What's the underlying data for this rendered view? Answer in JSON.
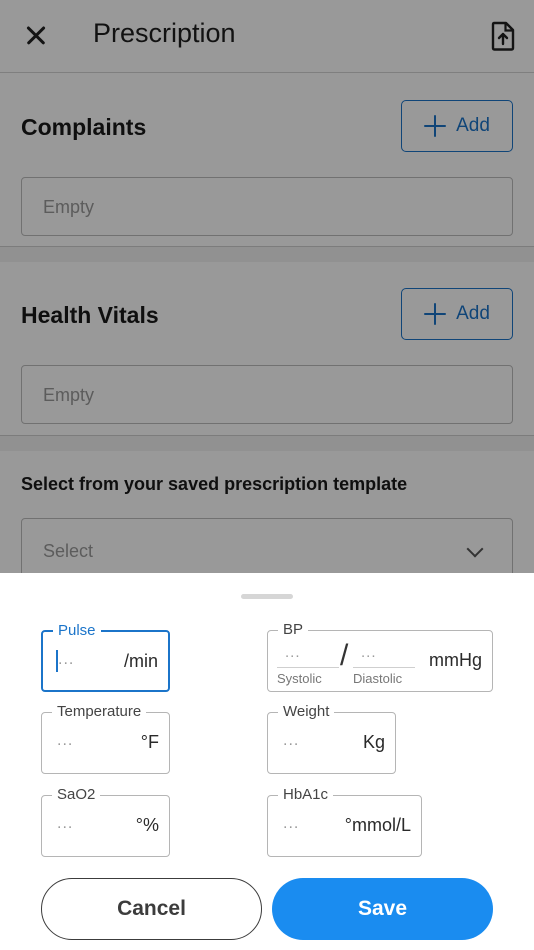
{
  "app_bar": {
    "title": "Prescription",
    "close_icon": "close-icon",
    "export_icon": "file-upload-icon"
  },
  "complaints": {
    "title": "Complaints",
    "add_label": "Add",
    "value": "Empty"
  },
  "health_vitals": {
    "title": "Health Vitals",
    "add_label": "Add",
    "value": "Empty"
  },
  "template": {
    "label": "Select from your saved prescription template",
    "placeholder": "Select",
    "dropdown_icon": "chevron-down-icon"
  },
  "vitals_sheet": {
    "pulse": {
      "label": "Pulse",
      "placeholder": "...",
      "unit": "/min"
    },
    "bp": {
      "label": "BP",
      "systolic_placeholder": "...",
      "diastolic_placeholder": "...",
      "systolic_label": "Systolic",
      "diastolic_label": "Diastolic",
      "separator": "/",
      "unit": "mmHg"
    },
    "temperature": {
      "label": "Temperature",
      "placeholder": "...",
      "unit": "°F"
    },
    "weight": {
      "label": "Weight",
      "placeholder": "...",
      "unit": "Kg"
    },
    "sao2": {
      "label": "SaO2",
      "placeholder": "...",
      "unit": "°%"
    },
    "hba1c": {
      "label": "HbA1c",
      "placeholder": "...",
      "unit": "°mmol/L"
    },
    "cancel_label": "Cancel",
    "save_label": "Save"
  },
  "colors": {
    "accent": "#1b74c9",
    "save_button": "#1a8cf0",
    "scrim": "#000000"
  }
}
